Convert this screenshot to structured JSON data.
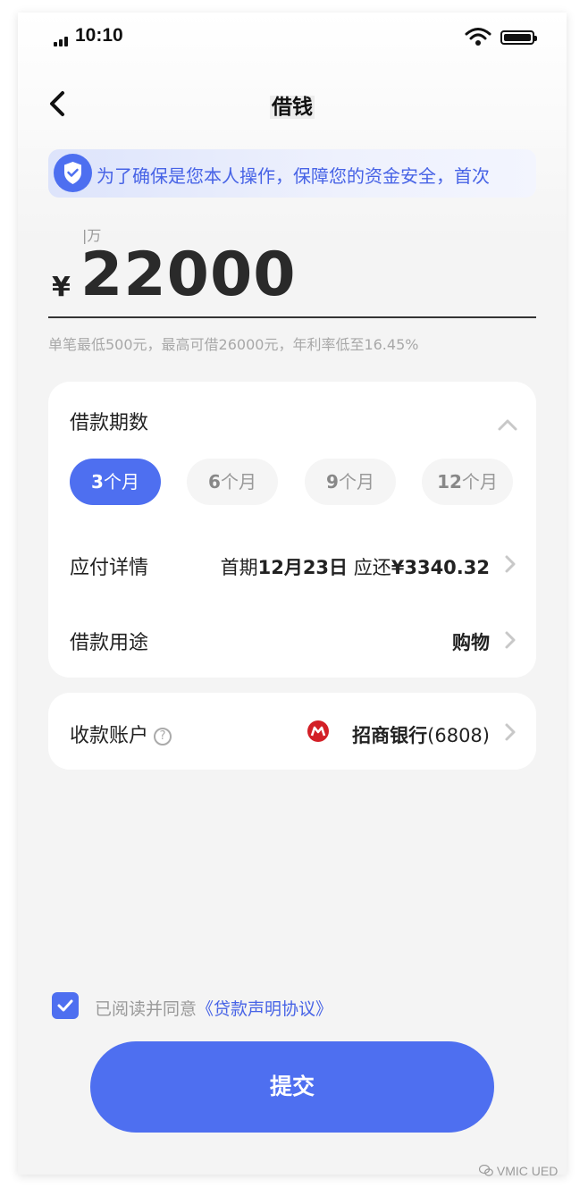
{
  "status_bar": {
    "time": "10:10"
  },
  "nav": {
    "title": "借钱"
  },
  "notice": {
    "text": "为了确保是您本人操作，保障您的资金安全，首次"
  },
  "amount": {
    "unit_hint": "万",
    "currency": "¥",
    "value": "22000",
    "limit_text": "单笔最低500元，最高可借26000元，年利率低至16.45%"
  },
  "loan_terms": {
    "label": "借款期数",
    "options": [
      {
        "num": "3",
        "unit": "个月",
        "selected": true
      },
      {
        "num": "6",
        "unit": "个月",
        "selected": false
      },
      {
        "num": "9",
        "unit": "个月",
        "selected": false
      },
      {
        "num": "12",
        "unit": "个月",
        "selected": false
      }
    ]
  },
  "payment_detail": {
    "label": "应付详情",
    "prefix": "首期",
    "first_date": "12月23日",
    "repay_label": " 应还",
    "repay_amount": "¥3340.32"
  },
  "purpose": {
    "label": "借款用途",
    "value": "购物"
  },
  "account": {
    "label": "收款账户",
    "help": "?",
    "bank": "招商银行",
    "card_suffix": "(6808)"
  },
  "agreement": {
    "checked": true,
    "prefix": "已阅读并同意",
    "link": "《贷款声明协议》"
  },
  "submit": {
    "label": "提交"
  },
  "watermark": {
    "text": "VMIC UED"
  },
  "colors": {
    "primary": "#4e6ff0",
    "notice_text": "#4763e6",
    "bank_red": "#d31f26"
  }
}
